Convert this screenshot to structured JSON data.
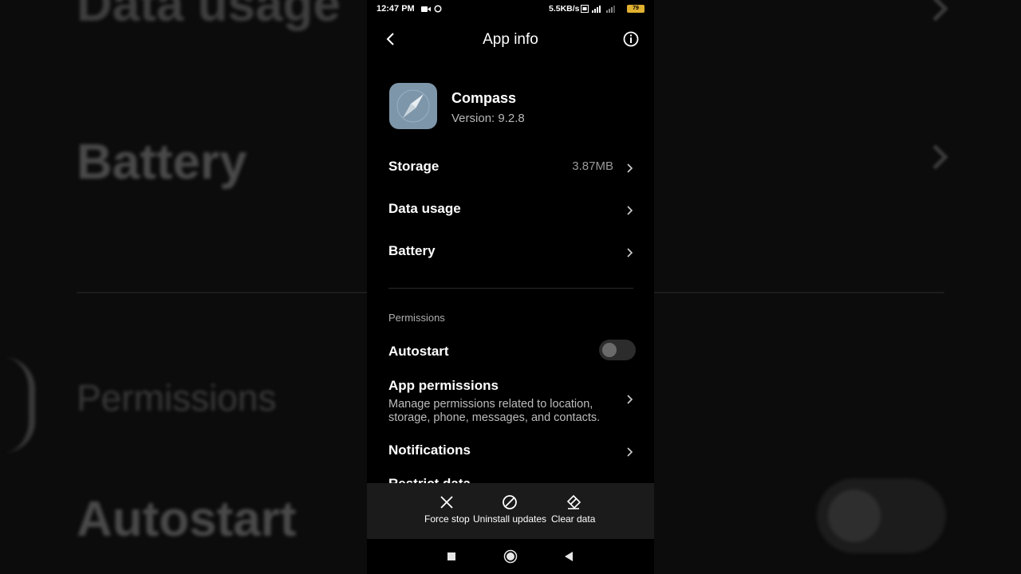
{
  "background": {
    "data_usage": "Data usage",
    "battery": "Battery",
    "permissions": "Permissions",
    "autostart": "Autostart"
  },
  "status_bar": {
    "time": "12:47 PM",
    "speed": "5.5KB/s",
    "battery_level": "79"
  },
  "header": {
    "title": "App info"
  },
  "app": {
    "name": "Compass",
    "version": "Version: 9.2.8",
    "icon": "compass-icon"
  },
  "rows": {
    "storage": {
      "label": "Storage",
      "value": "3.87MB"
    },
    "data_usage": {
      "label": "Data usage"
    },
    "battery": {
      "label": "Battery"
    }
  },
  "permissions": {
    "section_label": "Permissions",
    "autostart": {
      "label": "Autostart",
      "enabled": false
    },
    "app_permissions": {
      "label": "App permissions",
      "description": "Manage permissions related to location, storage, phone, messages, and contacts."
    },
    "notifications": {
      "label": "Notifications"
    },
    "restrict_data": {
      "label": "Restrict data"
    }
  },
  "actions": {
    "force_stop": "Force stop",
    "uninstall_updates": "Uninstall updates",
    "clear_data": "Clear data"
  },
  "colors": {
    "background": "#000000",
    "action_bar": "#1b1b1b",
    "app_icon_bg": "#7e96aa",
    "battery": "#e0b030"
  }
}
